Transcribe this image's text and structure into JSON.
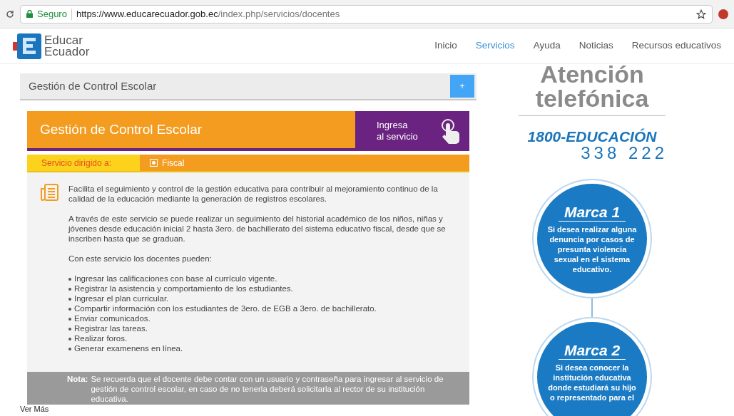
{
  "browser": {
    "security_label": "Seguro",
    "url_host": "https://www.educarecuador.gob.ec",
    "url_path": "/index.php/servicios/docentes"
  },
  "site": {
    "logo_line1": "Educar",
    "logo_line2": "Ecuador"
  },
  "nav": [
    {
      "label": "Inicio",
      "selected": false
    },
    {
      "label": "Servicios",
      "selected": true
    },
    {
      "label": "Ayuda",
      "selected": false
    },
    {
      "label": "Noticias",
      "selected": false
    },
    {
      "label": "Recursos educativos",
      "selected": false
    }
  ],
  "panel": {
    "title": "Gestión de Control Escolar",
    "toggle": "+"
  },
  "banner": {
    "title": "Gestión de Control Escolar",
    "cta_line1": "Ingresa",
    "cta_line2": "al servicio"
  },
  "audience": {
    "label": "Servicio dirigido a:",
    "options": [
      {
        "label": "Fiscal",
        "checked": true
      }
    ]
  },
  "description": [
    "Facilita el seguimiento y control de la gestión educativa para contribuir al mejoramiento continuo de la calidad de la educación mediante la generación de registros escolares.",
    "A través de este servicio se puede realizar un seguimiento del historial académico de los niños, niñas y jóvenes desde educación inicial 2 hasta 3ero. de bachillerato del sistema educativo fiscal, desde que se inscriben hasta que se graduan.",
    "Con este servicio los docentes pueden:"
  ],
  "features": [
    "Ingresar las calificaciones con base al currículo vigente.",
    "Registrar la asistencia y comportamiento de los estudiantes.",
    "Ingresar el plan curricular.",
    "Compartir información con los estudiantes de 3ero. de EGB a 3ero. de bachillerato.",
    "Enviar comunicados.",
    "Registrar las tareas.",
    "Realizar foros.",
    "Generar examenens en línea."
  ],
  "note": {
    "label": "Nota:",
    "text": "Se recuerda que el docente debe contar con un usuario y contraseña para ingresar al servicio de gestión de control escolar, en caso de no tenerla deberá solicitarla al rector de su institución educativa."
  },
  "more_link": "Ver Más",
  "sidebar": {
    "heading_line1": "Atención",
    "heading_line2": "telefónica",
    "phone_name": "1800-EDUCACIÓN",
    "phone_number": "338 222",
    "marks": [
      {
        "title": "Marca 1",
        "text": "Si desea realizar alguna denuncia por casos de presunta violencia sexual en el sistema educativo."
      },
      {
        "title": "Marca 2",
        "text": "Si desea conocer la institución educativa donde estudiará su hijo o representado para el"
      }
    ]
  }
}
